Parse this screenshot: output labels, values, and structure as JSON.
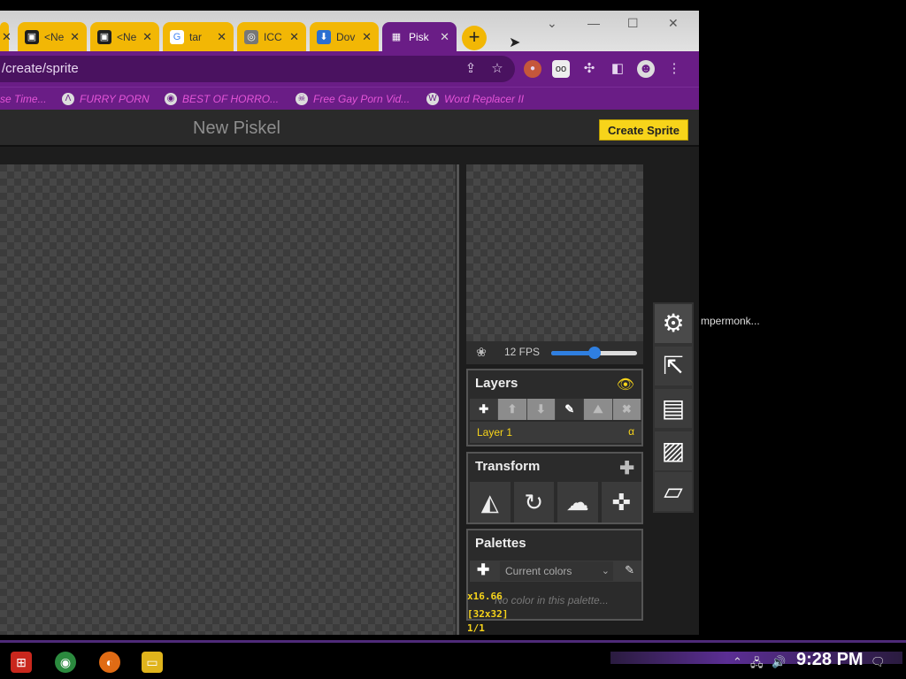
{
  "browser": {
    "tabs": [
      {
        "title": "<Ne",
        "fav_color": "#1e1e1e",
        "glyph": "▣"
      },
      {
        "title": "<Ne",
        "fav_color": "#1e1e1e",
        "glyph": "▣"
      },
      {
        "title": "tar",
        "fav_color": "#ffffff",
        "glyph": "G"
      },
      {
        "title": "ICC",
        "fav_color": "#777777",
        "glyph": "◎"
      },
      {
        "title": "Dov",
        "fav_color": "#2a6fd1",
        "glyph": "⬇"
      },
      {
        "title": "Pisk",
        "fav_color": "#6a1d86",
        "glyph": "▦"
      }
    ],
    "new_tab_glyph": "+",
    "url": "/create/sprite",
    "bookmarks": [
      {
        "label": "se Time...",
        "glyph": ""
      },
      {
        "label": "FURRY PORN",
        "glyph": "Λ"
      },
      {
        "label": "BEST OF HORRO...",
        "glyph": "◉"
      },
      {
        "label": "Free Gay Porn Vid...",
        "glyph": "☠"
      },
      {
        "label": "Word Replacer II",
        "glyph": "W"
      }
    ],
    "accent": "#6a1d86"
  },
  "app": {
    "title": "New Piskel",
    "create_button": "Create Sprite",
    "fps_label": "12 FPS",
    "fps_value": 12,
    "fps_max": 24,
    "layers": {
      "title": "Layers",
      "items": [
        {
          "name": "Layer 1",
          "alpha": "α"
        }
      ]
    },
    "transform": {
      "title": "Transform"
    },
    "palettes": {
      "title": "Palettes",
      "selected": "Current colors",
      "empty": "No color in this palette..."
    },
    "status": {
      "zoom": "x16.66",
      "size": "[32x32]",
      "frame": "1/1"
    },
    "side_text": "mpermonk..."
  },
  "taskbar": {
    "clock": "9:28 PM"
  }
}
